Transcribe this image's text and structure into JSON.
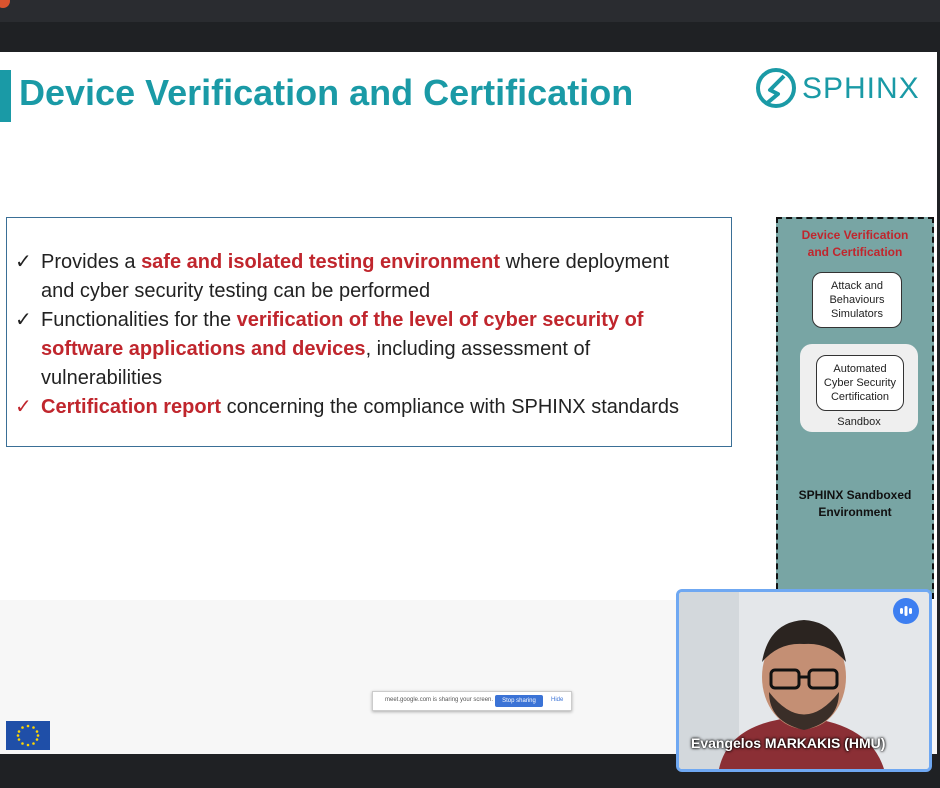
{
  "slide": {
    "title": "Device Verification and Certification",
    "logo_text": "SPHINX",
    "bullets": [
      {
        "lines": [
          [
            "Provides a ",
            "safe and isolated testing environment",
            " where deployment"
          ],
          [
            "and cyber security testing can be performed"
          ]
        ]
      },
      {
        "lines": [
          [
            "Functionalities for the ",
            "verification of the level of cyber security of"
          ],
          [
            "software applications and devices",
            ", including assessment of"
          ],
          [
            "vulnerabilities"
          ]
        ]
      },
      {
        "lines": [
          [
            "Certification report",
            " concerning the compliance with SPHINX standards"
          ]
        ]
      }
    ],
    "side_panel": {
      "title_line1": "Device Verification",
      "title_line2": "and Certification",
      "attack_line1": "Attack and",
      "attack_line2": "Behaviours",
      "attack_line3": "Simulators",
      "auto_line1": "Automated",
      "auto_line2": "Cyber Security",
      "auto_line3": "Certification",
      "sandbox_label": "Sandbox",
      "env_line1": "SPHINX Sandboxed",
      "env_line2": "Environment"
    }
  },
  "share_bar": {
    "message": "meet.google.com is sharing your screen.",
    "stop_label": "Stop sharing",
    "hide_label": "Hide"
  },
  "video": {
    "participant_name": "Evangelos MARKAKIS (HMU)"
  },
  "colors": {
    "accent": "#1a9aa6",
    "highlight_red": "#c0262d",
    "panel_bg": "#78a5a4"
  }
}
